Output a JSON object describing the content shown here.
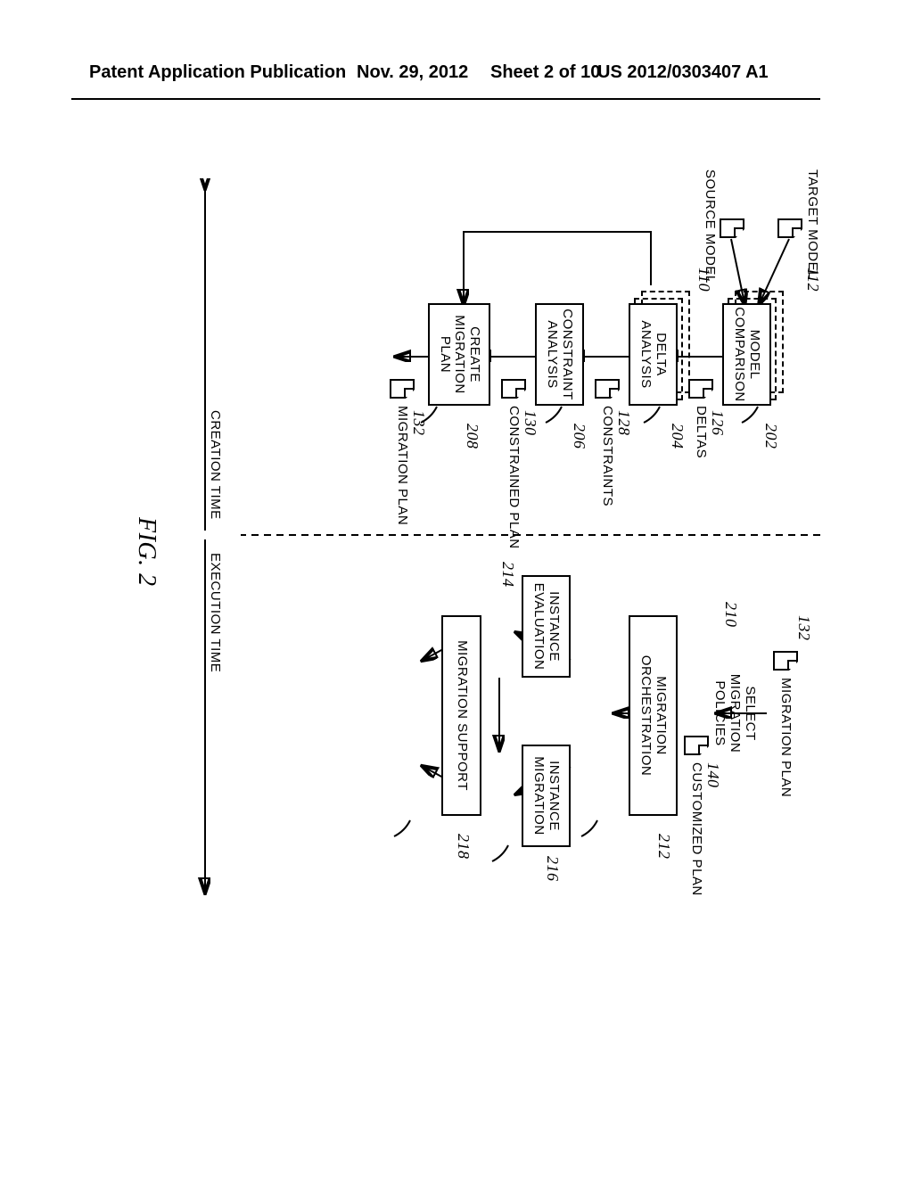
{
  "header": {
    "left": "Patent Application Publication",
    "mid_l": "Nov. 29, 2012",
    "mid_r": "Sheet 2 of 10",
    "right": "US 2012/0303407 A1"
  },
  "figure_label": "FIG. 2",
  "axis": {
    "creation": "CREATION TIME",
    "execution": "EXECUTION TIME"
  },
  "left": {
    "target_model": "TARGET MODEL",
    "source_model": "SOURCE MODEL",
    "model_comparison": "MODEL\nCOMPARISON",
    "deltas": "DELTAS",
    "delta_analysis": "DELTA\nANALYSIS",
    "constraints": "CONSTRAINTS",
    "constraint_analysis": "CONSTRAINT\nANALYSIS",
    "constrained_plan": "CONSTRAINED PLAN",
    "create_migration_plan": "CREATE\nMIGRATION\nPLAN",
    "migration_plan": "MIGRATION PLAN"
  },
  "right": {
    "migration_plan_top": "MIGRATION PLAN",
    "select_migration_policies": "SELECT\nMIGRATION\nPOLICIES",
    "customized_plan": "CUSTOMIZED PLAN",
    "migration_orchestration": "MIGRATION\nORCHESTRATION",
    "instance_evaluation": "INSTANCE\nEVALUATION",
    "instance_migration": "INSTANCE\nMIGRATION",
    "migration_support": "MIGRATION SUPPORT"
  },
  "ref": {
    "r112": "112",
    "r110": "110",
    "r202": "202",
    "r126": "126",
    "r204": "204",
    "r128": "128",
    "r206": "206",
    "r130": "130",
    "r208": "208",
    "r132": "132",
    "r132b": "132",
    "r210": "210",
    "r140": "140",
    "r212": "212",
    "r214": "214",
    "r216": "216",
    "r218": "218"
  }
}
